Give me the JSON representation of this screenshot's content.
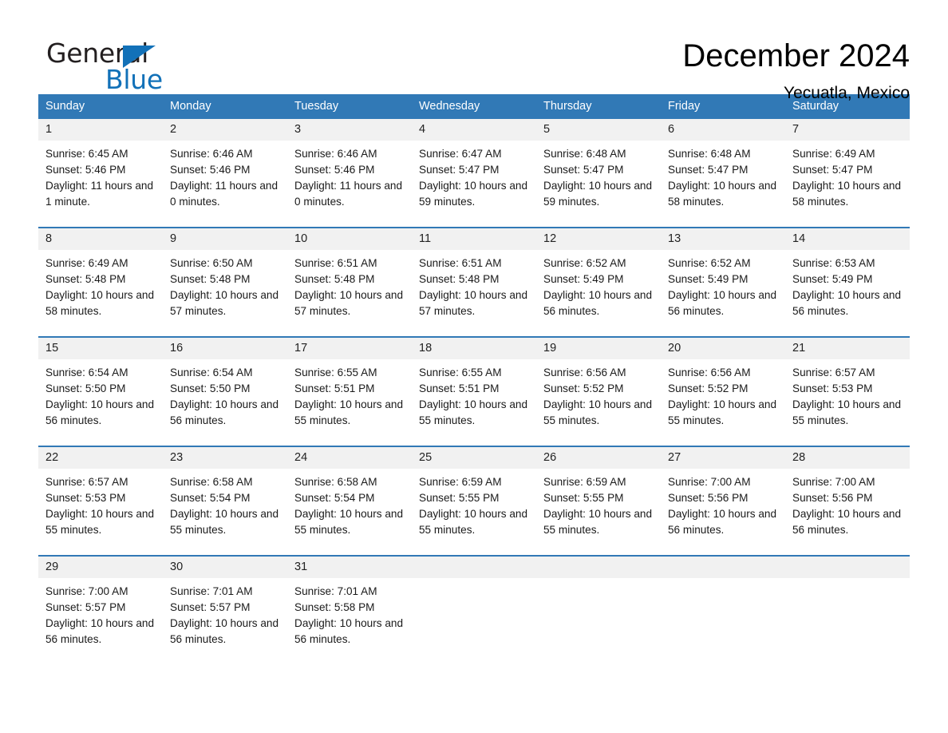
{
  "brand": {
    "word_one": "General",
    "word_two": "Blue",
    "flag_icon": "triangle-flag-icon",
    "accent_color": "#1271b8"
  },
  "header": {
    "month_title": "December 2024",
    "location": "Yecuatla, Mexico"
  },
  "theme": {
    "header_blue": "#3179b6",
    "date_band_gray": "#f1f1f1",
    "divider_blue": "#3179b6"
  },
  "calendar": {
    "weekdays": [
      "Sunday",
      "Monday",
      "Tuesday",
      "Wednesday",
      "Thursday",
      "Friday",
      "Saturday"
    ],
    "weeks": [
      {
        "days": [
          {
            "date": "1",
            "sunrise": "Sunrise: 6:45 AM",
            "sunset": "Sunset: 5:46 PM",
            "daylight": "Daylight: 11 hours and 1 minute."
          },
          {
            "date": "2",
            "sunrise": "Sunrise: 6:46 AM",
            "sunset": "Sunset: 5:46 PM",
            "daylight": "Daylight: 11 hours and 0 minutes."
          },
          {
            "date": "3",
            "sunrise": "Sunrise: 6:46 AM",
            "sunset": "Sunset: 5:46 PM",
            "daylight": "Daylight: 11 hours and 0 minutes."
          },
          {
            "date": "4",
            "sunrise": "Sunrise: 6:47 AM",
            "sunset": "Sunset: 5:47 PM",
            "daylight": "Daylight: 10 hours and 59 minutes."
          },
          {
            "date": "5",
            "sunrise": "Sunrise: 6:48 AM",
            "sunset": "Sunset: 5:47 PM",
            "daylight": "Daylight: 10 hours and 59 minutes."
          },
          {
            "date": "6",
            "sunrise": "Sunrise: 6:48 AM",
            "sunset": "Sunset: 5:47 PM",
            "daylight": "Daylight: 10 hours and 58 minutes."
          },
          {
            "date": "7",
            "sunrise": "Sunrise: 6:49 AM",
            "sunset": "Sunset: 5:47 PM",
            "daylight": "Daylight: 10 hours and 58 minutes."
          }
        ]
      },
      {
        "days": [
          {
            "date": "8",
            "sunrise": "Sunrise: 6:49 AM",
            "sunset": "Sunset: 5:48 PM",
            "daylight": "Daylight: 10 hours and 58 minutes."
          },
          {
            "date": "9",
            "sunrise": "Sunrise: 6:50 AM",
            "sunset": "Sunset: 5:48 PM",
            "daylight": "Daylight: 10 hours and 57 minutes."
          },
          {
            "date": "10",
            "sunrise": "Sunrise: 6:51 AM",
            "sunset": "Sunset: 5:48 PM",
            "daylight": "Daylight: 10 hours and 57 minutes."
          },
          {
            "date": "11",
            "sunrise": "Sunrise: 6:51 AM",
            "sunset": "Sunset: 5:48 PM",
            "daylight": "Daylight: 10 hours and 57 minutes."
          },
          {
            "date": "12",
            "sunrise": "Sunrise: 6:52 AM",
            "sunset": "Sunset: 5:49 PM",
            "daylight": "Daylight: 10 hours and 56 minutes."
          },
          {
            "date": "13",
            "sunrise": "Sunrise: 6:52 AM",
            "sunset": "Sunset: 5:49 PM",
            "daylight": "Daylight: 10 hours and 56 minutes."
          },
          {
            "date": "14",
            "sunrise": "Sunrise: 6:53 AM",
            "sunset": "Sunset: 5:49 PM",
            "daylight": "Daylight: 10 hours and 56 minutes."
          }
        ]
      },
      {
        "days": [
          {
            "date": "15",
            "sunrise": "Sunrise: 6:54 AM",
            "sunset": "Sunset: 5:50 PM",
            "daylight": "Daylight: 10 hours and 56 minutes."
          },
          {
            "date": "16",
            "sunrise": "Sunrise: 6:54 AM",
            "sunset": "Sunset: 5:50 PM",
            "daylight": "Daylight: 10 hours and 56 minutes."
          },
          {
            "date": "17",
            "sunrise": "Sunrise: 6:55 AM",
            "sunset": "Sunset: 5:51 PM",
            "daylight": "Daylight: 10 hours and 55 minutes."
          },
          {
            "date": "18",
            "sunrise": "Sunrise: 6:55 AM",
            "sunset": "Sunset: 5:51 PM",
            "daylight": "Daylight: 10 hours and 55 minutes."
          },
          {
            "date": "19",
            "sunrise": "Sunrise: 6:56 AM",
            "sunset": "Sunset: 5:52 PM",
            "daylight": "Daylight: 10 hours and 55 minutes."
          },
          {
            "date": "20",
            "sunrise": "Sunrise: 6:56 AM",
            "sunset": "Sunset: 5:52 PM",
            "daylight": "Daylight: 10 hours and 55 minutes."
          },
          {
            "date": "21",
            "sunrise": "Sunrise: 6:57 AM",
            "sunset": "Sunset: 5:53 PM",
            "daylight": "Daylight: 10 hours and 55 minutes."
          }
        ]
      },
      {
        "days": [
          {
            "date": "22",
            "sunrise": "Sunrise: 6:57 AM",
            "sunset": "Sunset: 5:53 PM",
            "daylight": "Daylight: 10 hours and 55 minutes."
          },
          {
            "date": "23",
            "sunrise": "Sunrise: 6:58 AM",
            "sunset": "Sunset: 5:54 PM",
            "daylight": "Daylight: 10 hours and 55 minutes."
          },
          {
            "date": "24",
            "sunrise": "Sunrise: 6:58 AM",
            "sunset": "Sunset: 5:54 PM",
            "daylight": "Daylight: 10 hours and 55 minutes."
          },
          {
            "date": "25",
            "sunrise": "Sunrise: 6:59 AM",
            "sunset": "Sunset: 5:55 PM",
            "daylight": "Daylight: 10 hours and 55 minutes."
          },
          {
            "date": "26",
            "sunrise": "Sunrise: 6:59 AM",
            "sunset": "Sunset: 5:55 PM",
            "daylight": "Daylight: 10 hours and 55 minutes."
          },
          {
            "date": "27",
            "sunrise": "Sunrise: 7:00 AM",
            "sunset": "Sunset: 5:56 PM",
            "daylight": "Daylight: 10 hours and 56 minutes."
          },
          {
            "date": "28",
            "sunrise": "Sunrise: 7:00 AM",
            "sunset": "Sunset: 5:56 PM",
            "daylight": "Daylight: 10 hours and 56 minutes."
          }
        ]
      },
      {
        "days": [
          {
            "date": "29",
            "sunrise": "Sunrise: 7:00 AM",
            "sunset": "Sunset: 5:57 PM",
            "daylight": "Daylight: 10 hours and 56 minutes."
          },
          {
            "date": "30",
            "sunrise": "Sunrise: 7:01 AM",
            "sunset": "Sunset: 5:57 PM",
            "daylight": "Daylight: 10 hours and 56 minutes."
          },
          {
            "date": "31",
            "sunrise": "Sunrise: 7:01 AM",
            "sunset": "Sunset: 5:58 PM",
            "daylight": "Daylight: 10 hours and 56 minutes."
          },
          {
            "date": "",
            "sunrise": "",
            "sunset": "",
            "daylight": ""
          },
          {
            "date": "",
            "sunrise": "",
            "sunset": "",
            "daylight": ""
          },
          {
            "date": "",
            "sunrise": "",
            "sunset": "",
            "daylight": ""
          },
          {
            "date": "",
            "sunrise": "",
            "sunset": "",
            "daylight": ""
          }
        ]
      }
    ]
  }
}
